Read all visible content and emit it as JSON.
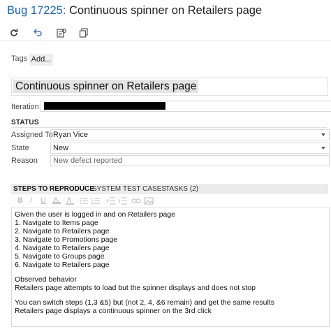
{
  "header": {
    "bug_id": "Bug 17225:",
    "title": "Continuous spinner on Retailers page"
  },
  "toolbar": {
    "icons": [
      "refresh-icon",
      "undo-icon",
      "template-icon",
      "copy-icon"
    ]
  },
  "tags": {
    "label": "Tags",
    "add_label": "Add..."
  },
  "work_item": {
    "title_value": "Continuous spinner on Retailers page"
  },
  "fields": {
    "iteration_label": "Iteration",
    "status_heading": "STATUS",
    "assigned_label": "Assigned To",
    "assigned_value": "Ryan Vice",
    "state_label": "State",
    "state_value": "New",
    "reason_label": "Reason",
    "reason_value": "New defect reported"
  },
  "tabs": {
    "steps": "STEPS TO REPRODUCE",
    "system": "SYSTEM",
    "test_cases": "TEST CASES",
    "tasks": "TASKS (2)"
  },
  "formatting": {
    "bold": "B",
    "italic": "I",
    "underline": "U"
  },
  "editor": {
    "lines": [
      "Given the user is logged in and on Retailers page",
      "1. Navigate to Items page",
      "2. Navigate to Retailers page",
      "3. Navigate to Promotions page",
      "4. Navigate to Retailers page",
      "5. Navigate to Groups page",
      "6. Navigate to Retailers page",
      "",
      "Observed behavior",
      "Retailers page attempts to load but the spinner displays and does not stop",
      "",
      "You can switch steps (1,3 &5) but (not 2, 4, &6 remain) and get the same results",
      "Retailers page displays a continuous spinner on the 3rd click"
    ]
  },
  "colors": {
    "accent": "#1565c0",
    "tab_strip": "#ececec"
  }
}
